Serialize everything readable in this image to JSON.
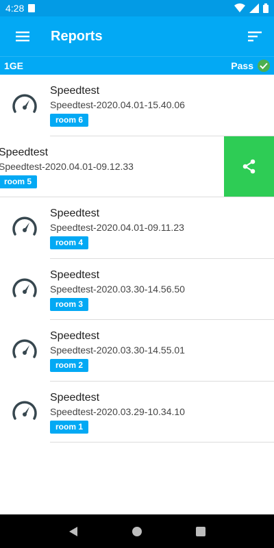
{
  "status": {
    "time": "4:28"
  },
  "header": {
    "title": "Reports"
  },
  "subbar": {
    "network": "1GE",
    "status": "Pass"
  },
  "colors": {
    "primary": "#03a9f4",
    "share": "#2ecc55",
    "pass": "#4caf50"
  },
  "reports": [
    {
      "title": "Speedtest",
      "name": "Speedtest-2020.04.01-15.40.06",
      "room": "room 6"
    },
    {
      "title": "Speedtest",
      "name": "Speedtest-2020.04.01-09.12.33",
      "room": "room 5"
    },
    {
      "title": "Speedtest",
      "name": "Speedtest-2020.04.01-09.11.23",
      "room": "room 4"
    },
    {
      "title": "Speedtest",
      "name": "Speedtest-2020.03.30-14.56.50",
      "room": "room 3"
    },
    {
      "title": "Speedtest",
      "name": "Speedtest-2020.03.30-14.55.01",
      "room": "room 2"
    },
    {
      "title": "Speedtest",
      "name": "Speedtest-2020.03.29-10.34.10",
      "room": "room 1"
    }
  ],
  "icons": {
    "menu": "hamburger-menu-icon",
    "sort": "sort-icon",
    "report": "speedometer-icon",
    "share": "share-icon",
    "pass": "check-icon"
  }
}
